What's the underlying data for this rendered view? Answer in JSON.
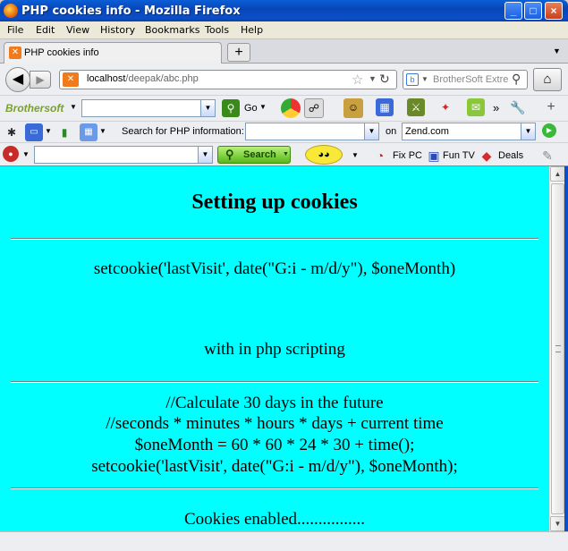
{
  "window": {
    "title": "PHP cookies info - Mozilla Firefox",
    "controls": {
      "minimize": "_",
      "maximize": "□",
      "close": "×"
    }
  },
  "menu": [
    "File",
    "Edit",
    "View",
    "History",
    "Bookmarks",
    "Tools",
    "Help"
  ],
  "tabs": [
    {
      "label": "PHP cookies info"
    }
  ],
  "nav": {
    "url_host": "localhost",
    "url_path": "/deepak/abc.php",
    "search_placeholder": "BrotherSoft Extre"
  },
  "toolbar1": {
    "brand": "Brothersoft",
    "go_label": "Go",
    "more": "»"
  },
  "toolbar2": {
    "search_php_label": "Search for PHP information:",
    "on_label": "on",
    "engine_value": "Zend.com"
  },
  "toolbar3": {
    "search_button": "Search",
    "fixpc": "Fix PC",
    "funtv": "Fun TV",
    "deals": "Deals"
  },
  "content": {
    "heading": "Setting up cookies",
    "line1": "setcookie('lastVisit', date(\"G:i - m/d/y\"), $oneMonth)",
    "line2": "with in php scripting",
    "code": [
      "//Calculate 30 days in the future",
      "//seconds * minutes * hours * days + current time",
      "$oneMonth = 60 * 60 * 24 * 30 + time();",
      "setcookie('lastVisit', date(\"G:i - m/d/y\"), $oneMonth);"
    ],
    "status_line": "Cookies enabled................"
  },
  "colors": {
    "page_background": "#00ffff",
    "titlebar": "#0a4fc8"
  }
}
